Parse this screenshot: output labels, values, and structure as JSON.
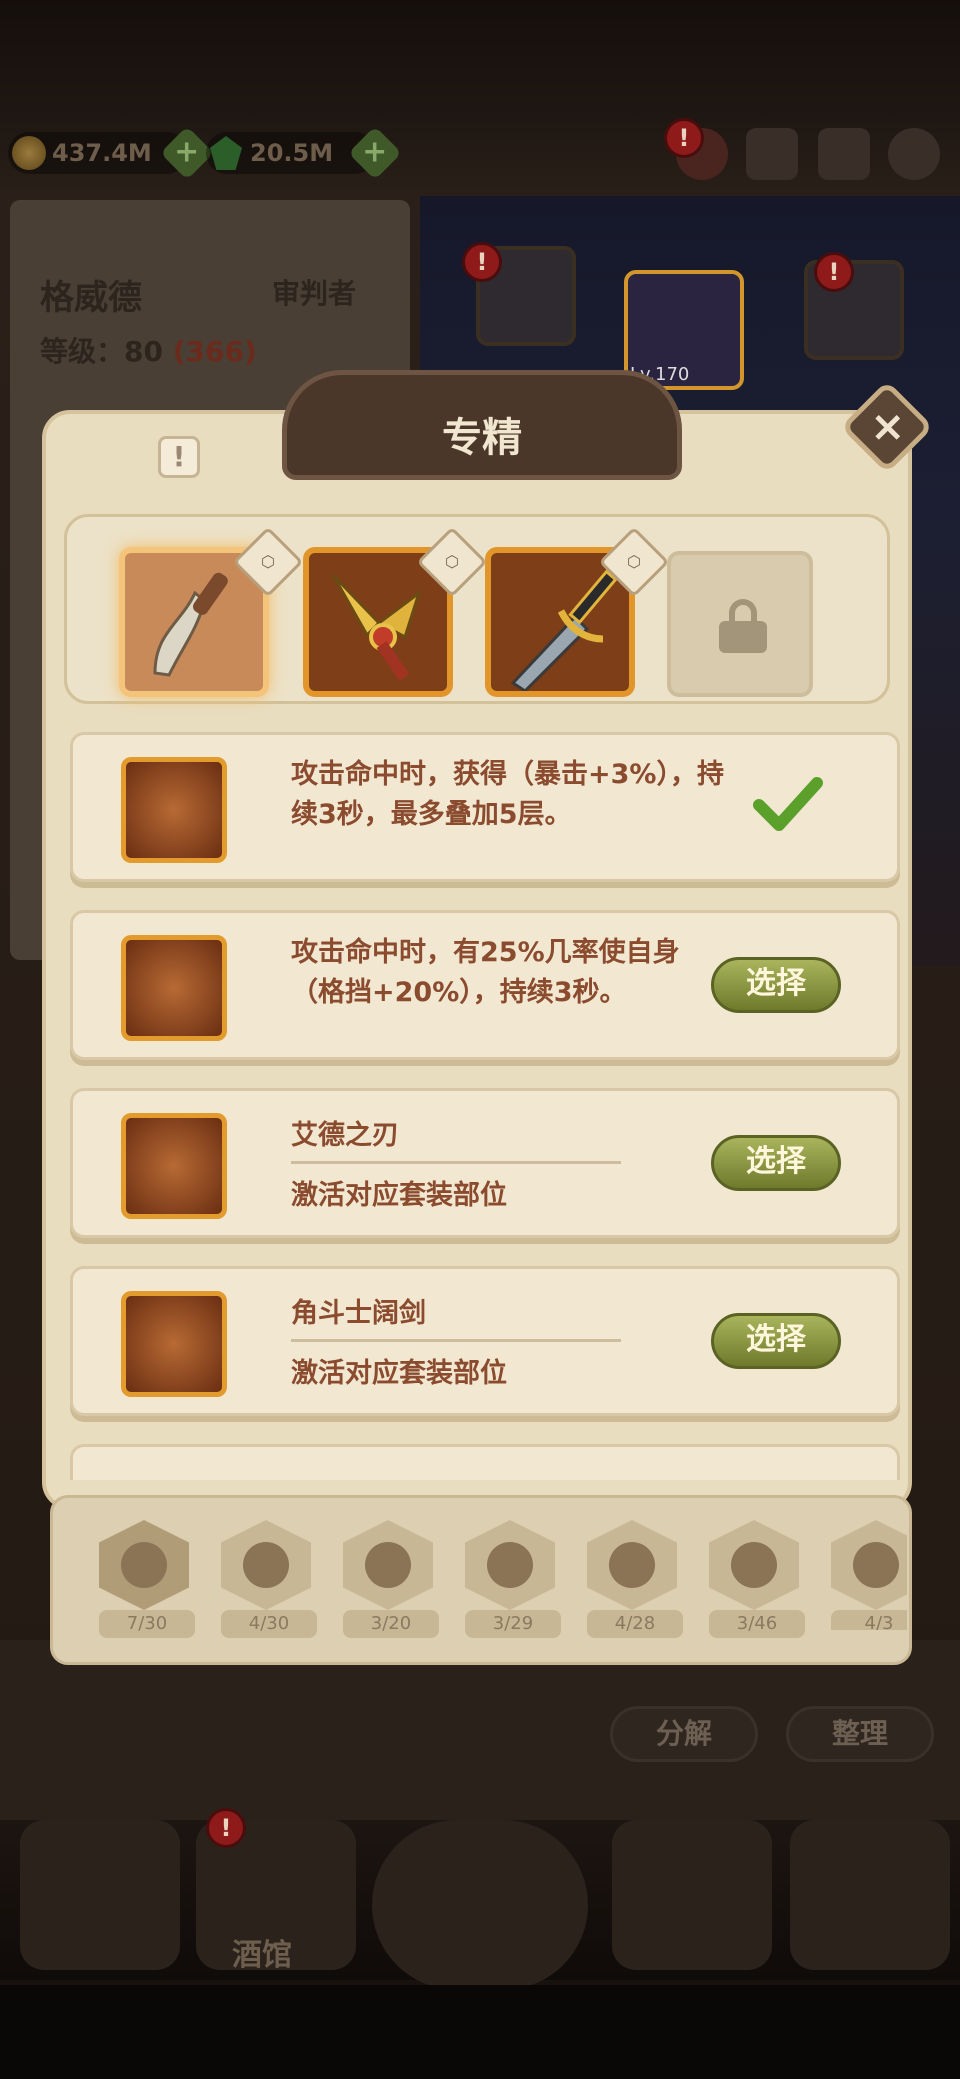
{
  "resources": {
    "gold": "437.4M",
    "gems": "20.5M"
  },
  "alerts": {
    "mark": "!"
  },
  "character": {
    "name": "格威德",
    "class": "审判者",
    "level_label": "等级：80",
    "level_bonus": "(366)"
  },
  "scene": {
    "item_level": "Lv.170"
  },
  "modal": {
    "title": "专精",
    "close": "×",
    "info": "!",
    "slots": [
      {
        "icon": "curved-dagger-icon",
        "selected": true
      },
      {
        "icon": "golden-trident-icon",
        "selected": false
      },
      {
        "icon": "golden-sword-icon",
        "selected": false
      },
      {
        "icon": "lock-icon",
        "locked": true
      }
    ],
    "cards": [
      {
        "text": "攻击命中时，获得（暴击+3%），持续3秒，最多叠加5层。",
        "state": "selected"
      },
      {
        "text": "攻击命中时，有25%几率使自身（格挡+20%），持续3秒。",
        "button": "选择"
      },
      {
        "title": "艾德之刃",
        "subtitle": "激活对应套装部位",
        "button": "选择"
      },
      {
        "title": "角斗士阔剑",
        "subtitle": "激活对应套装部位",
        "button": "选择"
      }
    ],
    "categories": [
      {
        "icon": "gauntlet-icon",
        "count": "7/30"
      },
      {
        "icon": "drumstick-icon",
        "count": "4/30"
      },
      {
        "icon": "dagger-icon",
        "count": "3/20"
      },
      {
        "icon": "shield-icon",
        "count": "3/29"
      },
      {
        "icon": "book-icon",
        "count": "4/28"
      },
      {
        "icon": "beast-head-icon",
        "count": "3/46"
      },
      {
        "icon": "magnifier-icon",
        "count": "4/3"
      }
    ]
  },
  "actions": {
    "decompose": "分解",
    "organize": "整理"
  },
  "nav": {
    "tavern": "酒馆"
  }
}
